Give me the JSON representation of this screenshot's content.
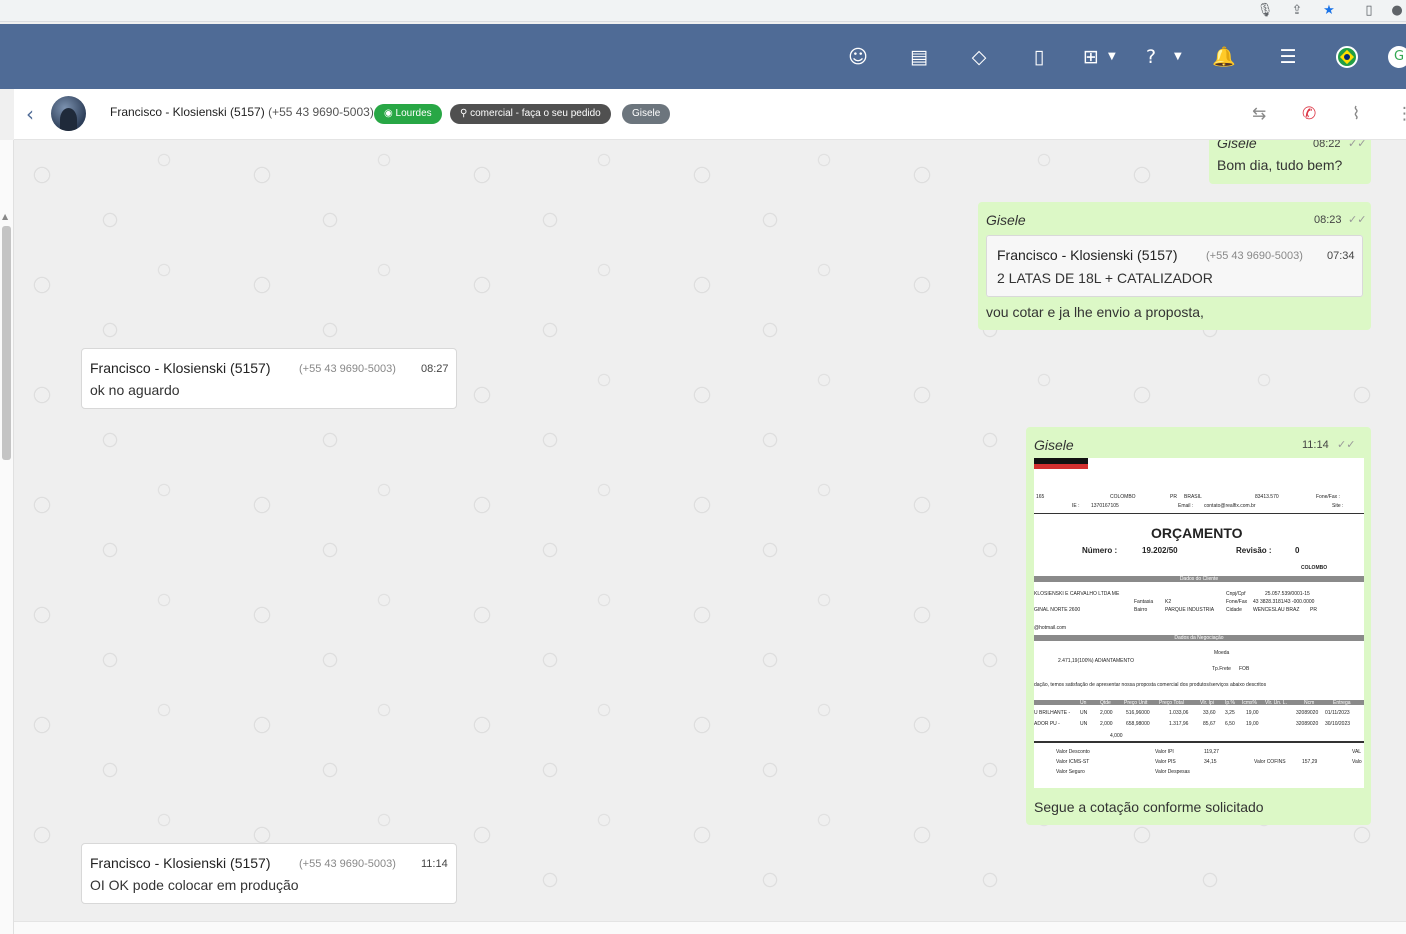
{
  "header": {
    "contact_name": "Francisco - Klosienski (5157)",
    "contact_phone": "(+55 43 9690-5003)",
    "tags": [
      "Lourdes",
      "comercial - faça o seu pedido",
      "Gisele"
    ]
  },
  "messages": [
    {
      "sender": "Gisele",
      "time": "08:22",
      "text": "Bom dia, tudo bem?"
    },
    {
      "sender": "Gisele",
      "time": "08:23",
      "quote": {
        "name": "Francisco - Klosienski (5157)",
        "phone": "(+55 43 9690-5003)",
        "time": "07:34",
        "text": "2 LATAS DE 18L + CATALIZADOR"
      },
      "text": "vou cotar e ja lhe envio a proposta,"
    },
    {
      "sender_name": "Francisco - Klosienski (5157)",
      "phone": "(+55 43 9690-5003)",
      "time": "08:27",
      "text": "ok no aguardo"
    },
    {
      "sender": "Gisele",
      "time": "11:14",
      "caption": "Segue a cotação conforme solicitado",
      "document": {
        "title": "ORÇAMENTO",
        "numero_label": "Número :",
        "numero": "19.202/50",
        "revisao_label": "Revisão :",
        "revisao": "0",
        "city": "COLOMBO",
        "state": "PR",
        "country": "BRASIL",
        "cep": "83413.570",
        "ie_label": "IE :",
        "ie": "1370167105",
        "email_label": "Email :",
        "email": "contato@realfix.com.br",
        "fone_label": "Fone/Fax :",
        "site_label": "Site :",
        "street_no": "165",
        "date_city": "COLOMBO",
        "section_client": "Dados do Cliente",
        "client_name": "KLOSIENSKI E CARVALHO LTDA ME",
        "cnpj_label": "Cnpj/Cpf",
        "cnpj": "25.057.539/0001-15",
        "fantasia_label": "Fantasia",
        "fantasia": "K2",
        "fonefax_label": "Fone/Fax",
        "fonefax": "43 3828.3181/43 -000.0000",
        "address": "GINAL NORTE 2600",
        "bairro_label": "Bairro",
        "bairro": "PARQUE INDUSTRIA",
        "cidade_label": "Cidade",
        "cidade": "WENCESLAU BRAZ",
        "client_state": "PR",
        "email_client": "@hotmail.com",
        "section_negotiation": "Dados da Negociação",
        "moeda_label": "Moeda",
        "payment": "2.471,19(100%) ADIANTAMENTO",
        "frete_label": "Tp.Frete",
        "frete": "FOB",
        "intro": "dação, temos satisfação de apresentar nossa proposta comercial dos produtos/serviços abaixo descritos",
        "columns": [
          "Un",
          "Qtde",
          "Preço Unit",
          "Preço Total",
          "Vlr. Ipi",
          "Ip.%",
          "Icms%",
          "Vlr. Un. L.",
          "Ncm",
          "Entrega"
        ],
        "rows": [
          [
            "U BRILHANTE -",
            "UN",
            "2,000",
            "516,96000",
            "1.033,06",
            "33,60",
            "3,25",
            "19,00",
            "",
            "32089020",
            "01/11/2023"
          ],
          [
            "ADOR PU -",
            "UN",
            "2,000",
            "658,98000",
            "1.317,96",
            "85,67",
            "6,50",
            "19,00",
            "",
            "32089020",
            "30/10/2023"
          ]
        ],
        "total_qty": "4,000",
        "valor_desconto_label": "Valor Desconto",
        "valor_ipi_label": "Valor IPI",
        "valor_ipi": "119,27",
        "valor_icms_label": "Valor ICMS-ST",
        "valor_pis_label": "Valor PIS",
        "valor_pis": "34,15",
        "valor_cofins_label": "Valor COFINS",
        "valor_cofins": "157,29",
        "valor_seguro_label": "Valor Seguro",
        "valor_despesas_label": "Valor Despesas",
        "partial_right": [
          "VAL",
          "Valo"
        ]
      }
    },
    {
      "sender_name": "Francisco - Klosienski (5157)",
      "phone": "(+55 43 9690-5003)",
      "time": "11:14",
      "text": "OI OK pode colocar em produção"
    }
  ],
  "colors": {
    "nav": "#4f6b96",
    "outgoing": "#dcf8c6",
    "incoming": "#ffffff",
    "tag_green": "#28a745",
    "tag_dark": "#505050",
    "tag_gray": "#6c757d"
  },
  "icons": [
    "mic-icon",
    "share-icon",
    "star-icon",
    "extension-icon",
    "profile-icon",
    "chat-icon",
    "contacts-icon",
    "tag-icon",
    "phone-vibrate-icon",
    "apps-grid-icon",
    "help-icon",
    "bell-icon",
    "list-icon",
    "brazil-flag-icon",
    "user-avatar-icon",
    "back-icon",
    "transfer-icon",
    "end-call-icon",
    "attach-icon",
    "more-icon",
    "read-check-icon"
  ]
}
